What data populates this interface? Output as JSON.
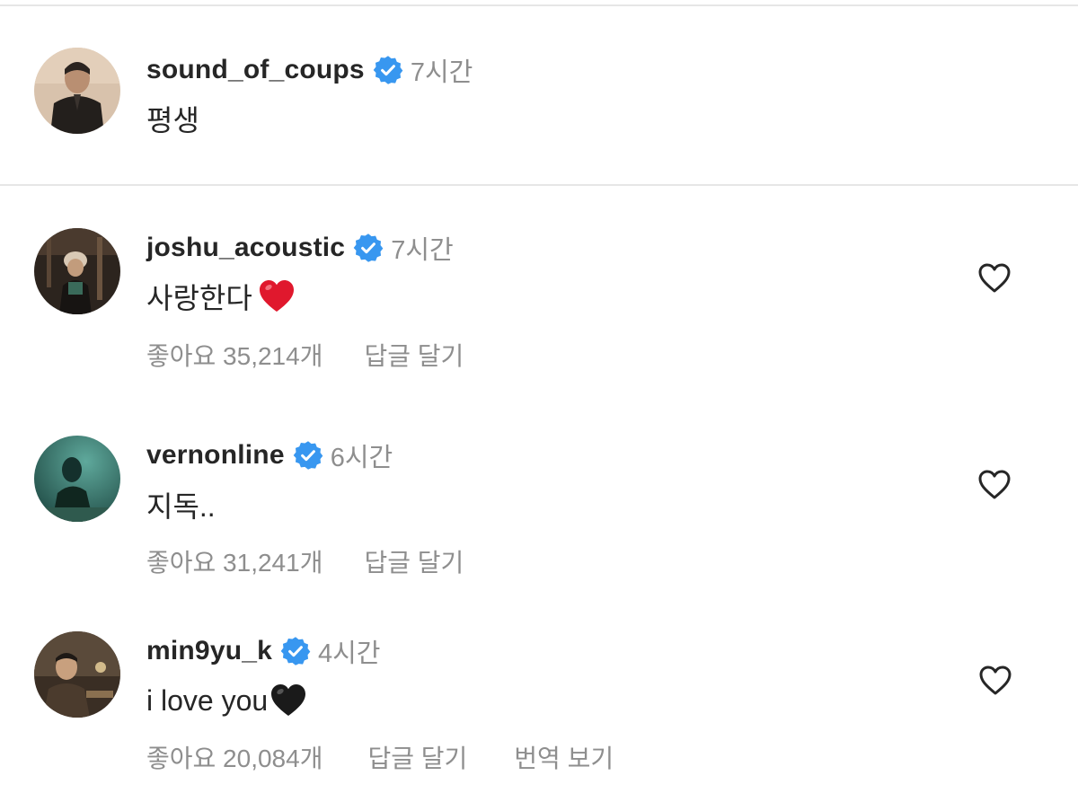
{
  "caption": {
    "username": "sound_of_coups",
    "time": "7시간",
    "text": "평생"
  },
  "comments": [
    {
      "username": "joshu_acoustic",
      "time": "7시간",
      "text": "사랑한다",
      "emoji": "red-heart",
      "likes": "좋아요 35,214개",
      "reply": "답글 달기"
    },
    {
      "username": "vernonline",
      "time": "6시간",
      "text": "지독..",
      "likes": "좋아요 31,241개",
      "reply": "답글 달기"
    },
    {
      "username": "min9yu_k",
      "time": "4시간",
      "text": "i love you",
      "emoji": "black-heart",
      "likes": "좋아요 20,084개",
      "reply": "답글 달기",
      "translate": "번역 보기"
    }
  ],
  "colors": {
    "verified": "#3897f0",
    "muted": "#8e8e8e",
    "text": "#262626",
    "heart_red": "#e0182d",
    "heart_black": "#1a1a1a"
  }
}
